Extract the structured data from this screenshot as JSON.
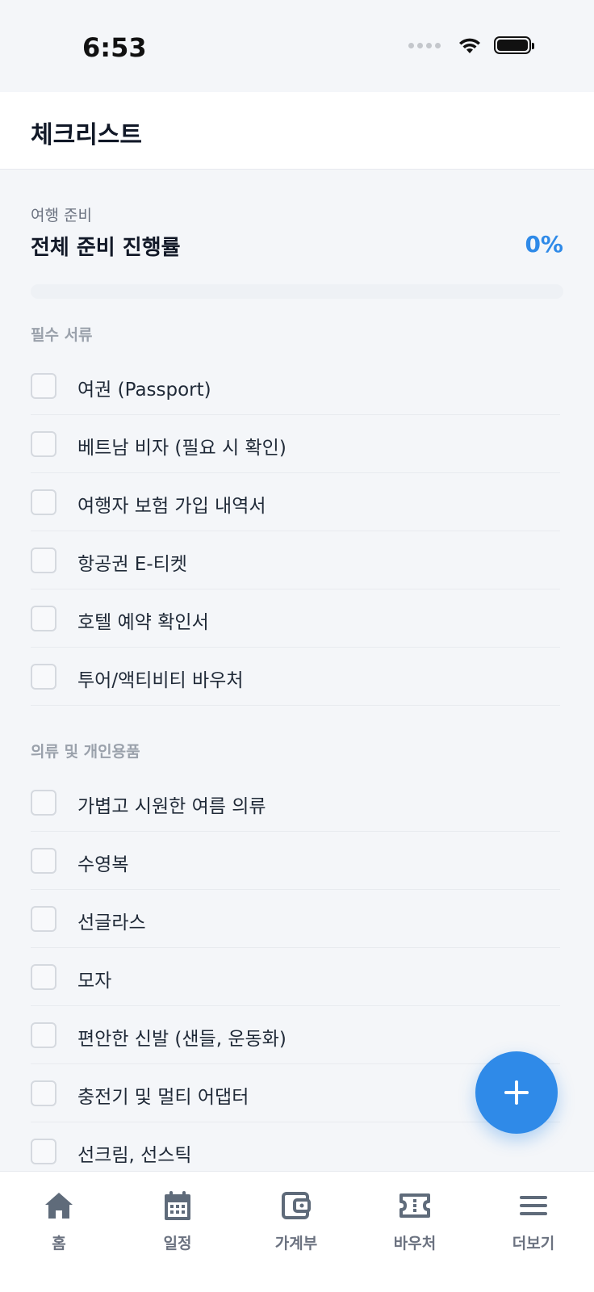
{
  "status_bar": {
    "time": "6:53"
  },
  "header": {
    "title": "체크리스트"
  },
  "progress": {
    "caption": "여행 준비",
    "title": "전체 준비 진행률",
    "percent_label": "0%",
    "value": 0
  },
  "sections": [
    {
      "title": "필수 서류",
      "items": [
        {
          "label": "여권 (Passport)"
        },
        {
          "label": "베트남 비자 (필요 시 확인)"
        },
        {
          "label": "여행자 보험 가입 내역서"
        },
        {
          "label": "항공권 E-티켓"
        },
        {
          "label": "호텔 예약 확인서"
        },
        {
          "label": "투어/액티비티 바우처"
        }
      ]
    },
    {
      "title": "의류 및 개인용품",
      "items": [
        {
          "label": "가볍고 시원한 여름 의류"
        },
        {
          "label": "수영복"
        },
        {
          "label": "선글라스"
        },
        {
          "label": "모자"
        },
        {
          "label": "편안한 신발 (샌들, 운동화)"
        },
        {
          "label": "충전기 및 멀티 어댑터"
        },
        {
          "label": "선크림, 선스틱"
        }
      ]
    }
  ],
  "bottom_nav": [
    {
      "label": "홈",
      "icon": "home-icon"
    },
    {
      "label": "일정",
      "icon": "calendar-icon"
    },
    {
      "label": "가계부",
      "icon": "wallet-icon"
    },
    {
      "label": "바우처",
      "icon": "ticket-icon"
    },
    {
      "label": "더보기",
      "icon": "menu-icon"
    }
  ],
  "colors": {
    "accent": "#2f8ae8",
    "nav_icon": "#5f6b7a"
  }
}
